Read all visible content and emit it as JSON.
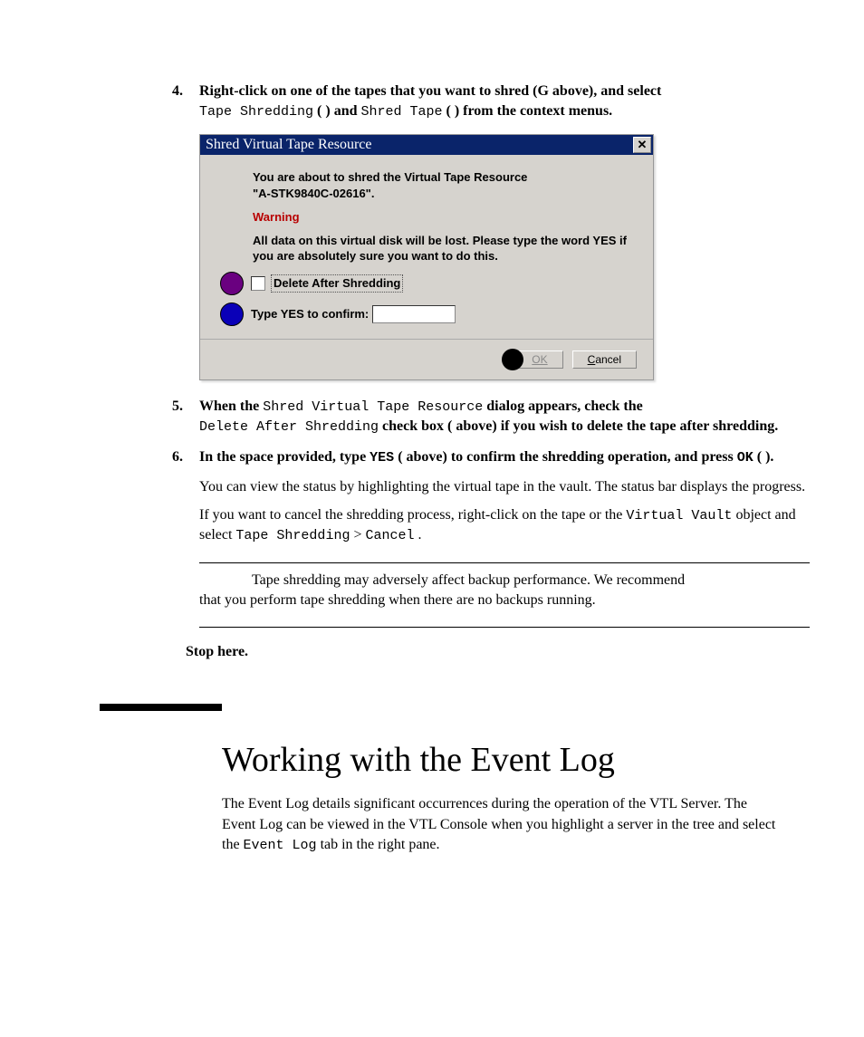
{
  "steps": {
    "s4": {
      "num": "4.",
      "lead1": "Right-click on one of the tapes that you want to shred (G above), and select ",
      "mono1": "Tape Shredding",
      "mid1": " ( ) and ",
      "mono2": "Shred Tape",
      "trail1": " ( ) from the context menus."
    },
    "s5": {
      "num": "5.",
      "lead": "When the ",
      "mono1": "Shred Virtual Tape Resource",
      "mid": " dialog appears, check the ",
      "mono2": "Delete After Shredding",
      "trail": " check box (  above) if you wish to delete the tape after shredding."
    },
    "s6": {
      "num": "6.",
      "lead": "In the space provided, type ",
      "mono1": "YES",
      "mid": " (  above) to confirm the shredding operation, and press ",
      "mono2": "OK",
      "trail": " (  ).",
      "para1": "You can view the status by highlighting the virtual tape in the vault. The status bar displays the progress.",
      "para2a": "If you want to cancel the shredding process, right-click on the tape or the ",
      "mono3": "Virtual Vault",
      "para2b": " object and select ",
      "mono4": "Tape Shredding",
      "para2c": " > ",
      "mono5": "Cancel",
      "para2d": "."
    }
  },
  "dialog": {
    "title": "Shred Virtual Tape Resource",
    "msg1a": "You are about to shred the Virtual Tape Resource",
    "msg1b": "\"A-STK9840C-02616\".",
    "warning": "Warning",
    "msg2": "All data on this virtual disk will be lost. Please type the word YES if you are absolutely sure you want to do this.",
    "checkbox_label": "Delete After Shredding",
    "confirm_label": "Type YES to confirm:",
    "ok_label": "OK",
    "cancel_prefix": "C",
    "cancel_rest": "ancel"
  },
  "note": {
    "line1": "Tape shredding may adversely affect backup performance. We recommend",
    "line2": "that you perform tape shredding when there are no backups running."
  },
  "stop": "Stop here.",
  "heading": "Working with the Event Log",
  "intro1": "The Event Log details significant occurrences during the operation of the VTL Server. The Event Log can be viewed in the VTL Console when you highlight a server in the tree and select the ",
  "intro_mono": "Event Log",
  "intro2": " tab in the right pane."
}
